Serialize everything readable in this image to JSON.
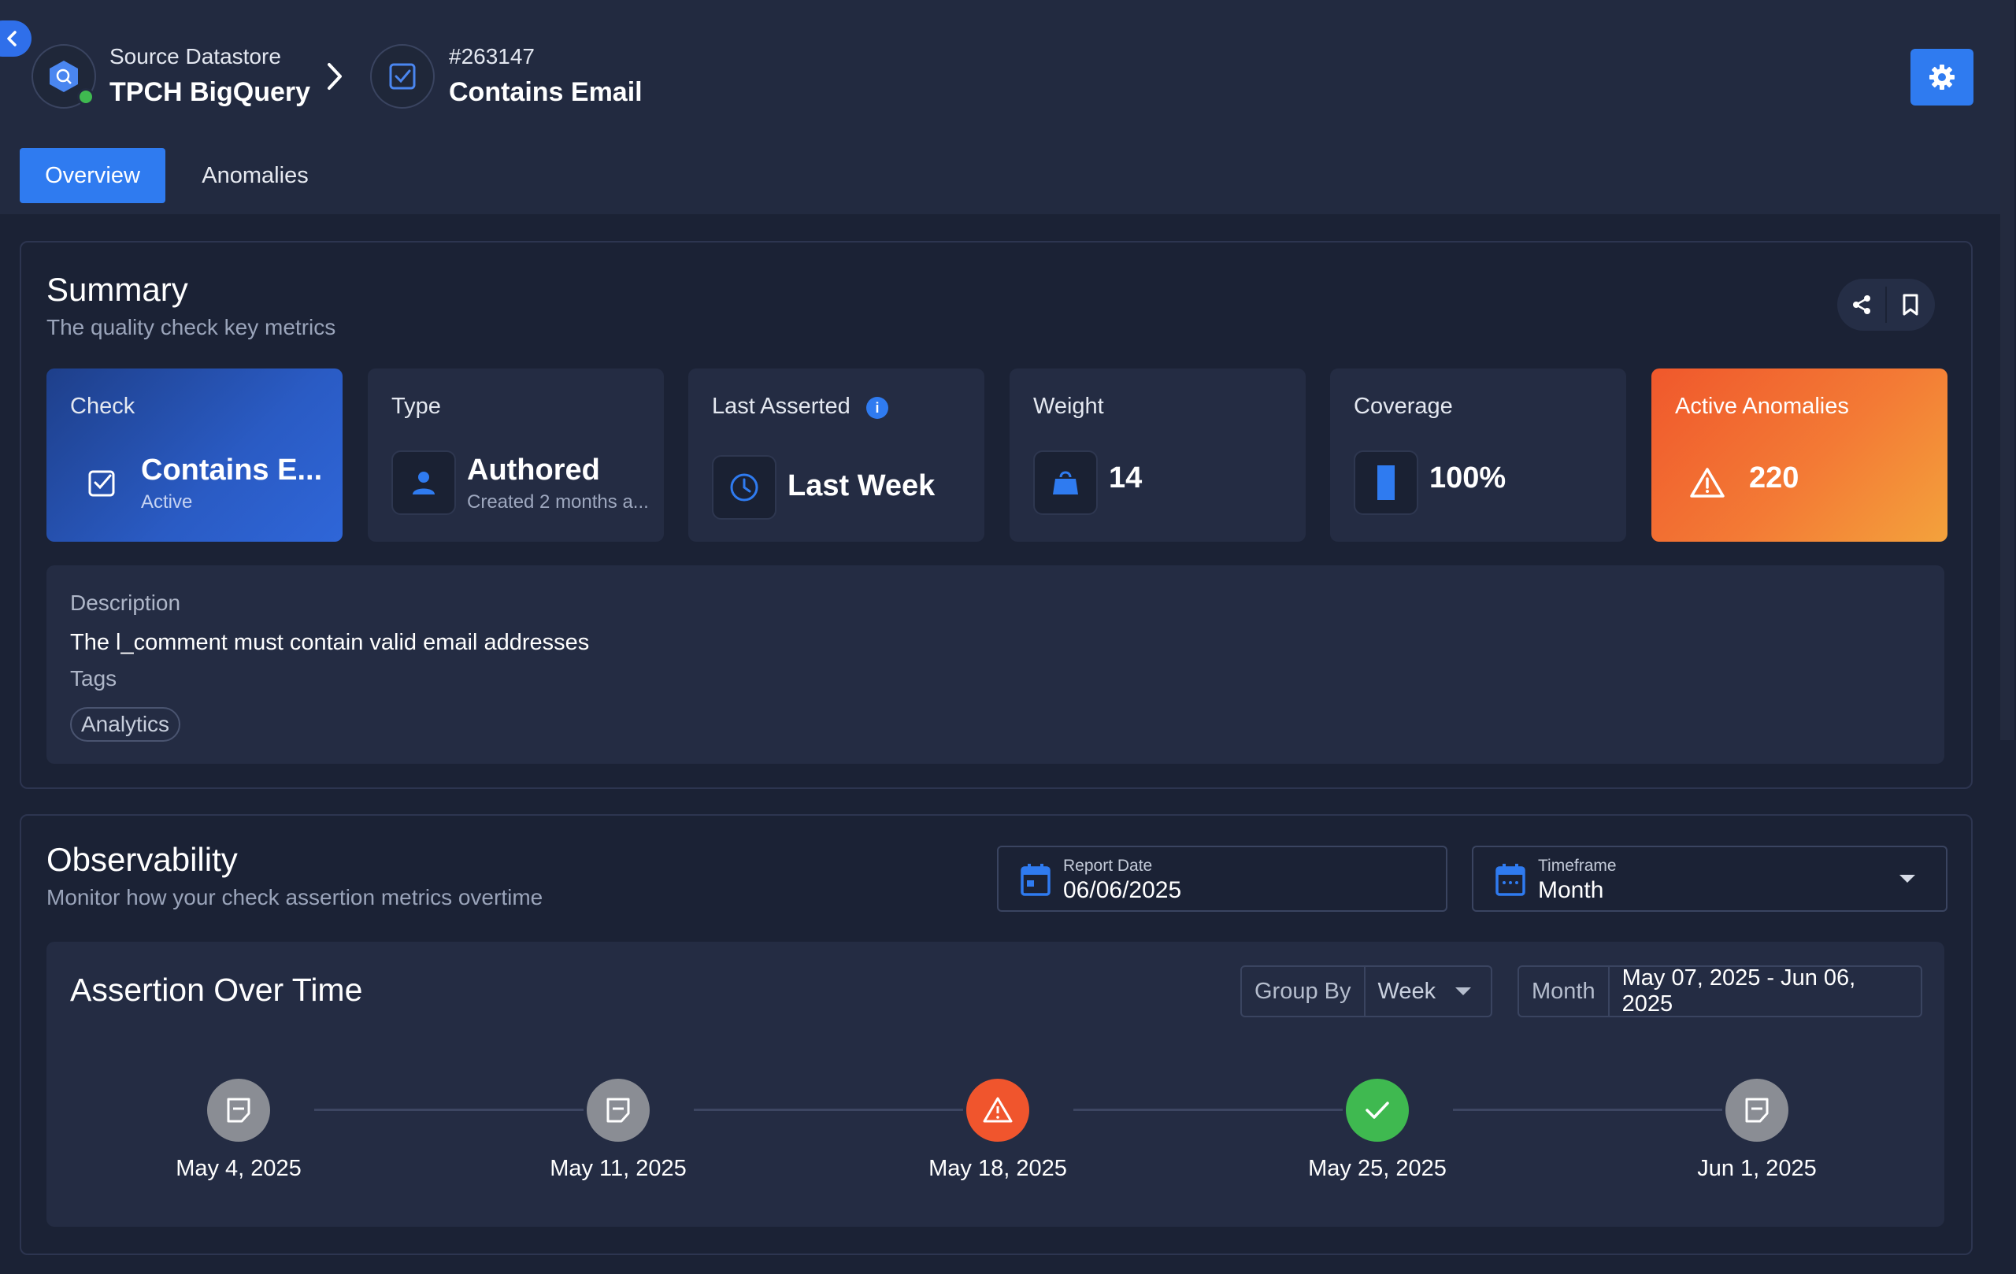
{
  "breadcrumb": {
    "source_label": "Source Datastore",
    "source_name": "TPCH BigQuery",
    "check_id": "#263147",
    "check_name": "Contains Email"
  },
  "tabs": [
    {
      "label": "Overview",
      "active": true
    },
    {
      "label": "Anomalies",
      "active": false
    }
  ],
  "summary": {
    "title": "Summary",
    "subtitle": "The quality check key metrics",
    "cards": {
      "check": {
        "label": "Check",
        "value": "Contains E...",
        "sub": "Active"
      },
      "type": {
        "label": "Type",
        "value": "Authored",
        "sub": "Created 2 months a..."
      },
      "asserted": {
        "label": "Last Asserted",
        "value": "Last Week",
        "info": "i"
      },
      "weight": {
        "label": "Weight",
        "value": "14"
      },
      "coverage": {
        "label": "Coverage",
        "value": "100%",
        "fraction": 1.0
      },
      "anomalies": {
        "label": "Active Anomalies",
        "value": "220"
      }
    },
    "description_label": "Description",
    "description": "The l_comment must contain valid email addresses",
    "tags_label": "Tags",
    "tags": [
      "Analytics"
    ]
  },
  "observability": {
    "title": "Observability",
    "subtitle": "Monitor how your check assertion metrics overtime",
    "report_date_label": "Report Date",
    "report_date": "06/06/2025",
    "timeframe_label": "Timeframe",
    "timeframe": "Month"
  },
  "assertion": {
    "title": "Assertion Over Time",
    "group_by_label": "Group By",
    "group_by_value": "Week",
    "range_label": "Month",
    "range_value": "May 07, 2025 - Jun 06, 2025",
    "timeline": [
      {
        "date": "May 4, 2025",
        "status": "no-data"
      },
      {
        "date": "May 11, 2025",
        "status": "no-data"
      },
      {
        "date": "May 18, 2025",
        "status": "anomaly"
      },
      {
        "date": "May 25, 2025",
        "status": "passed"
      },
      {
        "date": "Jun 1, 2025",
        "status": "no-data"
      }
    ]
  },
  "colors": {
    "accent": "#2f7bf0",
    "background": "#1b2235",
    "card": "#242c43",
    "anomaly": "#f0552d",
    "passed": "#3fb950",
    "no_data": "#8a8d94"
  },
  "icons": {
    "back": "chevron-left-icon",
    "datastore": "bigquery-icon",
    "check": "checkbox-icon",
    "settings": "gear-icon",
    "share": "share-icon",
    "bookmark": "bookmark-icon",
    "type": "user-icon",
    "asserted": "clock-icon",
    "weight": "weight-icon",
    "coverage": "bar-icon",
    "anomalies": "warning-icon",
    "calendar": "calendar-icon"
  }
}
